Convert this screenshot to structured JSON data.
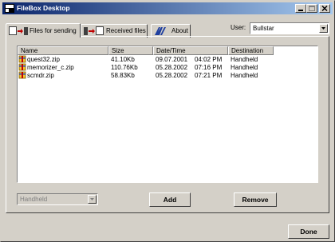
{
  "window": {
    "title": "FileBox Desktop"
  },
  "tabs": [
    {
      "label": "Files for sending",
      "active": true
    },
    {
      "label": "Received files",
      "active": false
    },
    {
      "label": "About",
      "active": false
    }
  ],
  "user": {
    "label": "User:",
    "value": "Bullstar"
  },
  "table": {
    "columns": [
      "Name",
      "Size",
      "Date/Time",
      "Destination"
    ],
    "rows": [
      {
        "name": "quest32.zip",
        "size": "41.10Kb",
        "date": "09.07.2001",
        "time": "04:02 PM",
        "destination": "Handheld"
      },
      {
        "name": "memorizer_c.zip",
        "size": "110.76Kb",
        "date": "05.28.2002",
        "time": "07:16 PM",
        "destination": "Handheld"
      },
      {
        "name": "scmdr.zip",
        "size": "58.83Kb",
        "date": "05.28.2002",
        "time": "07:21 PM",
        "destination": "Handheld"
      }
    ]
  },
  "destination_select": {
    "value": "Handheld",
    "disabled": true
  },
  "buttons": {
    "add": "Add",
    "remove": "Remove",
    "done": "Done"
  },
  "colors": {
    "title_bar_start": "#0a246a",
    "title_bar_end": "#a6caf0",
    "face": "#d4d0c8"
  },
  "icons": [
    "app-icon",
    "minimize-icon",
    "maximize-icon",
    "close-icon",
    "send-files-icon",
    "receive-files-icon",
    "about-logo-icon",
    "chevron-down-icon",
    "zip-file-icon"
  ]
}
